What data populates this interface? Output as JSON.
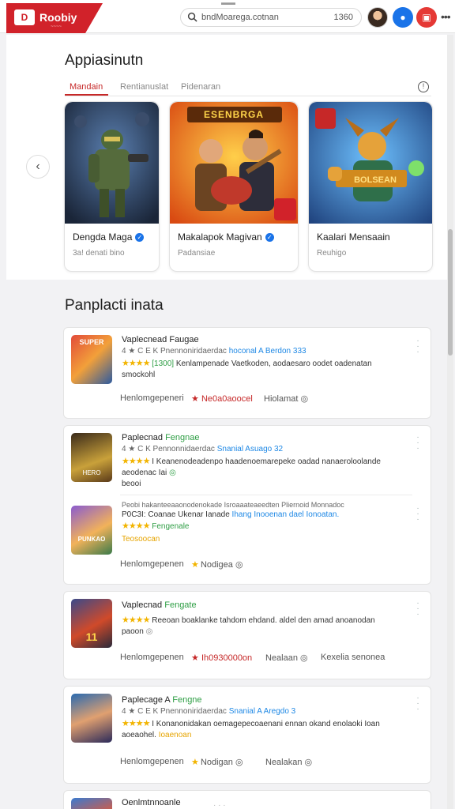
{
  "header": {
    "logo_text": "Roobiy",
    "logo_mark": "D",
    "logo_sub": "~~~~",
    "search_text": "bndMoarega.cotnan",
    "search_code": "1360",
    "icons": {
      "search": "search-icon",
      "notify": "bell-icon",
      "gift": "gift-icon",
      "menu": "more-icon"
    }
  },
  "featured": {
    "title": "Appiasinutn",
    "tabs": [
      "Mandain",
      "Rentianuslat",
      "Pidenaran"
    ],
    "cards": [
      {
        "name": "Dengda Maga",
        "sub": "3a! denati bino",
        "dots": "· · ·"
      },
      {
        "name": "Makalapok Magivan",
        "sub": "Padansiae",
        "dots": "Ia  ·  ·"
      },
      {
        "name": "Kaalari Mensaain",
        "sub": "Reuhigo",
        "dots": "·  ·  ·"
      }
    ],
    "banner_text": "ESENBRGA",
    "banner3_text": "BOLSEAN"
  },
  "list": {
    "title": "Panplacti inata",
    "items": [
      {
        "title": "Vaplecnead Faugae",
        "meta": "4 ★ C E K Pnennoniridaerdac",
        "meta_link": "hoconal A Berdon 333",
        "stars": "★★★★",
        "badge": "[1300]",
        "desc": "Kenlampenade Vaetkoden, aodaesaro oodet oadenatan",
        "desc2": "smockohl",
        "footer": [
          "Henlomgepeneri",
          "Ne0a0aoocel",
          "Hiolamat"
        ],
        "thumb_text": "SUPER"
      },
      {
        "title": "Paplecnad",
        "title_green": "Fengnae",
        "meta": "4 ★ C K Pennonnidaerdac",
        "meta_link": "Snanial Asuago 32",
        "stars": "★★★★",
        "desc": "I Keanenodeadenpo haadenoemarepeke oadad nanaeroloolande",
        "desc2": "aeodenac Iai",
        "desc3": "beooi",
        "line4": "Peobi hakanteeaaonodenokade Isroaaateaeedten Pliernoid Monnadoc",
        "line5_a": "P0C3I: Coanae Ukenar Ianade",
        "line5_b": "Ihang Inooenan dael Ionoatan.",
        "sub_stars": "★★★★",
        "sub_green": "Fengenale",
        "sub_orange": "Teosoocan",
        "footer": [
          "Henlomgepenen",
          "Nodigea"
        ],
        "thumb_text": "HERO",
        "thumb2_text": "PUNKAO"
      },
      {
        "title": "Vaplecnad",
        "title_green": "Fengate",
        "stars": "★★★★",
        "desc": "Reeoan boaklanke tahdom ehdand. aldel den amad anoanodan",
        "desc2": "paoon",
        "footer": [
          "Henlomgepenen",
          "Ih0930000on",
          "Nealaan",
          "Kexelia senonea"
        ],
        "thumb_text": "11"
      },
      {
        "title": "Paplecage A",
        "title_green": "Fengne",
        "meta": "4 ★ C E K Pnennoniridaerdac",
        "meta_link": "Snanial A Aregdo 3",
        "stars": "★★★★",
        "desc": "I Konanonidakan oemagepecoaenani ennan okand enolaoki Ioan",
        "desc2": "aoeaohel.",
        "desc2_orange": "Ioaenoan",
        "footer": [
          "Henlomgepenen",
          "Nodigan",
          "Nealakan"
        ],
        "thumb_text": ""
      },
      {
        "title": "Oenlmtnnoanle",
        "meta": "· · ·"
      }
    ]
  },
  "colors": {
    "brand": "#d1222a",
    "accent_blue": "#1a73e8",
    "green": "#2e9e44",
    "star": "#f2b400"
  }
}
